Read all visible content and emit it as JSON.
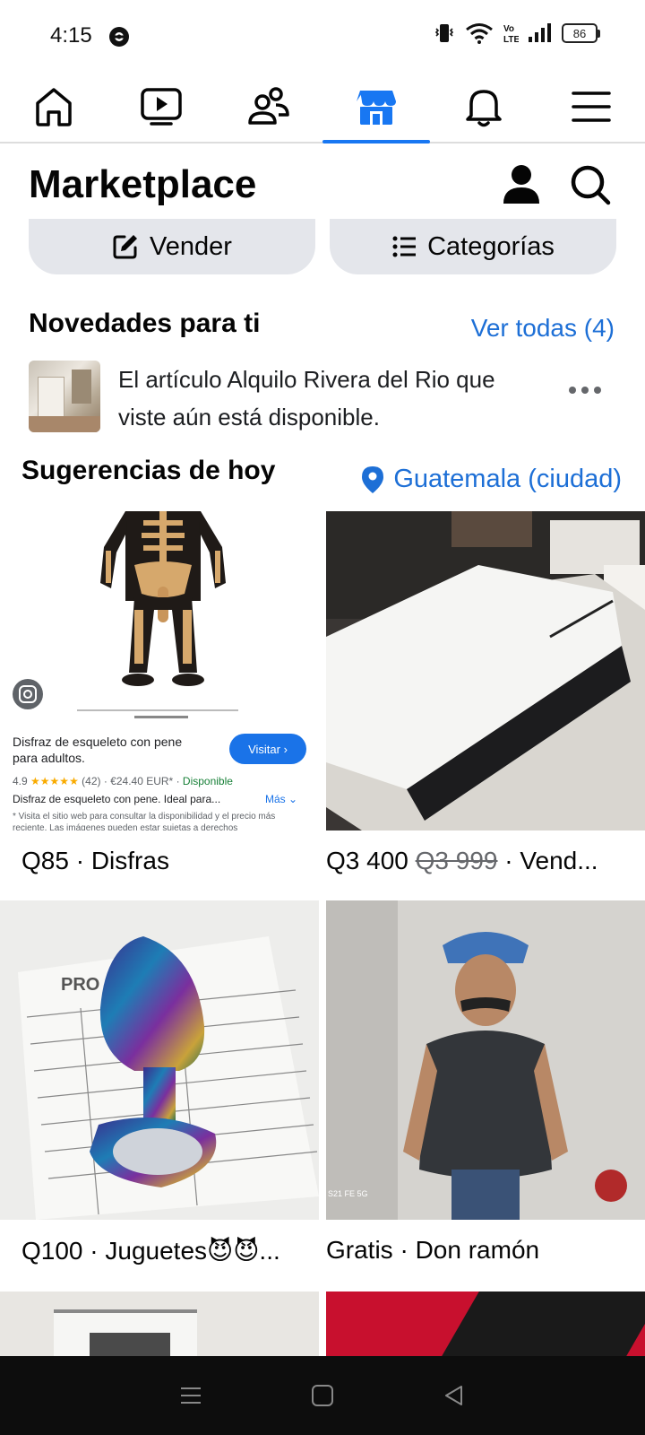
{
  "status_bar": {
    "time": "4:15",
    "battery": "86",
    "icons": [
      "vibrate-icon",
      "wifi-icon",
      "volte-icon",
      "signal-icon",
      "battery-icon"
    ]
  },
  "nav": {
    "tabs": [
      {
        "name": "home-icon",
        "active": false
      },
      {
        "name": "video-icon",
        "active": false
      },
      {
        "name": "friends-icon",
        "active": false
      },
      {
        "name": "marketplace-icon",
        "active": true
      },
      {
        "name": "bell-icon",
        "active": false
      },
      {
        "name": "menu-icon",
        "active": false
      }
    ],
    "accent": "#1877f2"
  },
  "header": {
    "title": "Marketplace"
  },
  "actions": {
    "sell_label": "Vender",
    "categories_label": "Categorías"
  },
  "updates": {
    "title": "Novedades para ti",
    "see_all": "Ver todas (4)",
    "notification_text": "El artículo Alquilo Rivera del Rio que viste aún está disponible."
  },
  "suggestions": {
    "title": "Sugerencias de hoy",
    "location": "Guatemala (ciudad)",
    "listings": [
      {
        "price": "Q85",
        "title": "Disfras"
      },
      {
        "price": "Q3 400",
        "old_price": "Q3 999",
        "title": "Vend..."
      },
      {
        "price": "Q100",
        "title": "Juguetes😈😈..."
      },
      {
        "price": "Gratis",
        "title": "Don ramón"
      }
    ]
  },
  "ad_overlay": {
    "title": "Disfraz de esqueleto con pene para adultos.",
    "visit": "Visitar",
    "rating": "4.9",
    "stars": "★★★★★",
    "reviews": "(42)",
    "price": "€24.40 EUR*",
    "availability": "Disponible",
    "description": "Disfraz de esqueleto con pene. Ideal para...",
    "more": "Más",
    "note": "* Visita el sitio web para consultar la disponibilidad y el precio más reciente. Las imágenes pueden estar sujetas a derechos"
  },
  "photo_text": {
    "watermark": "S21 FE 5G",
    "paper_heading": "PRO"
  },
  "colors": {
    "link": "#1d6fd6",
    "pill_bg": "#e4e6eb"
  }
}
